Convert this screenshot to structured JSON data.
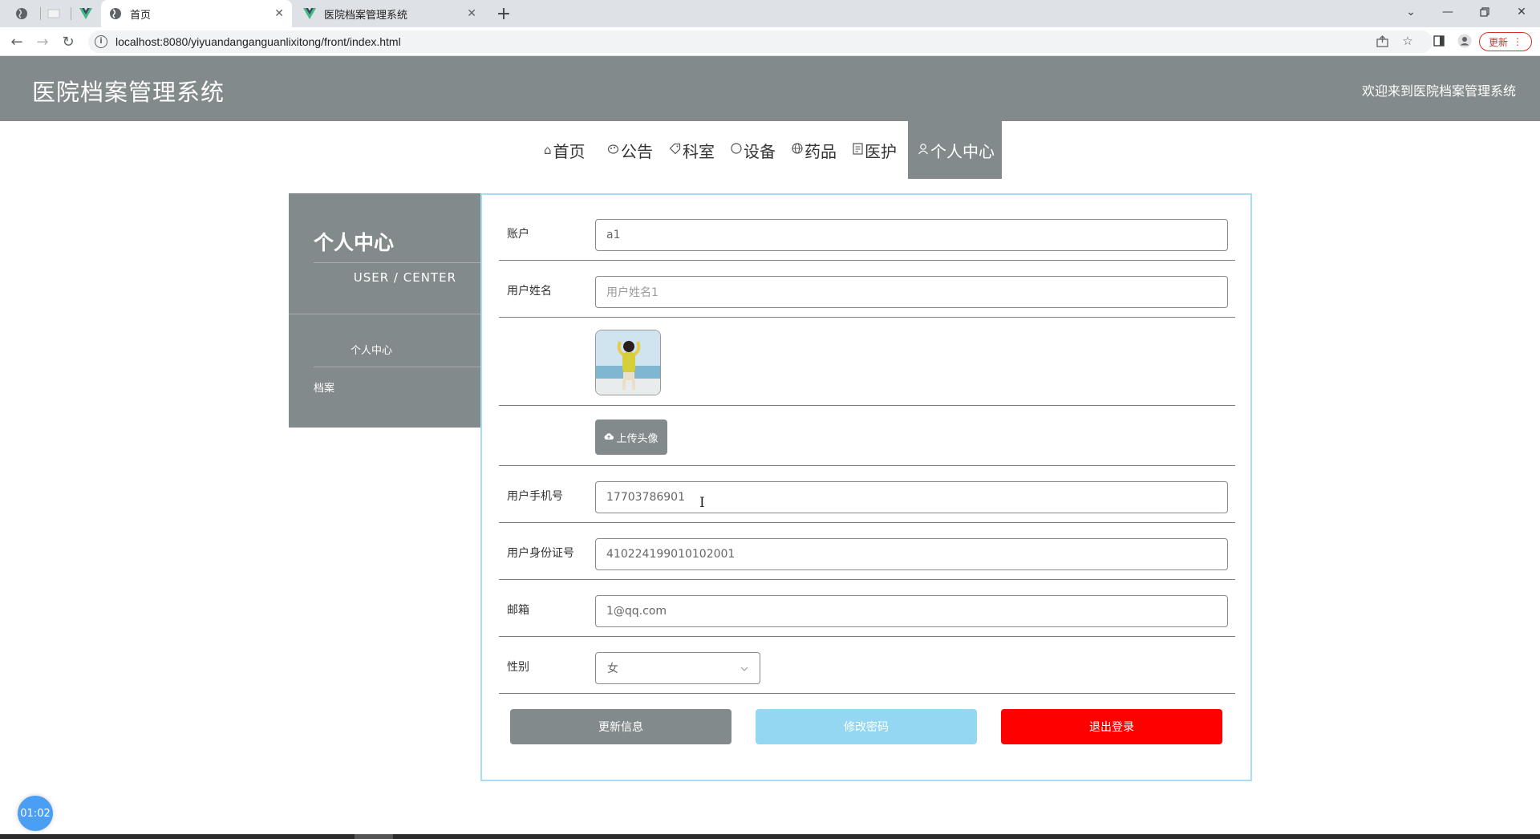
{
  "browser": {
    "tabs": [
      {
        "title": "首页",
        "active": true
      },
      {
        "title": "医院档案管理系统",
        "active": false
      }
    ],
    "url": "localhost:8080/yiyuandanganguanlixitong/front/index.html",
    "update_label": "更新"
  },
  "header": {
    "title": "医院档案管理系统",
    "welcome": "欢迎来到医院档案管理系统"
  },
  "nav": {
    "items": [
      {
        "label": "首页",
        "icon": "home-icon"
      },
      {
        "label": "公告",
        "icon": "announce-icon"
      },
      {
        "label": "科室",
        "icon": "tag-icon"
      },
      {
        "label": "设备",
        "icon": "circle-icon"
      },
      {
        "label": "药品",
        "icon": "globe-icon"
      },
      {
        "label": "医护",
        "icon": "doc-icon"
      },
      {
        "label": "个人中心",
        "icon": "user-icon",
        "active": true
      }
    ]
  },
  "sidebar": {
    "title": "个人中心",
    "subtitle": "USER / CENTER",
    "items": [
      {
        "label": "个人中心"
      },
      {
        "label": "档案"
      }
    ]
  },
  "form": {
    "account": {
      "label": "账户",
      "value": "a1"
    },
    "name": {
      "label": "用户姓名",
      "placeholder": "用户姓名1"
    },
    "upload_label": "上传头像",
    "phone": {
      "label": "用户手机号",
      "value": "17703786901"
    },
    "idcard": {
      "label": "用户身份证号",
      "value": "410224199010102001"
    },
    "email": {
      "label": "邮箱",
      "value": "1@qq.com"
    },
    "gender": {
      "label": "性别",
      "value": "女"
    },
    "buttons": {
      "update": "更新信息",
      "password": "修改密码",
      "logout": "退出登录"
    }
  },
  "colors": {
    "header_bg": "#838a8c",
    "panel_border": "#a9dcf0",
    "password_btn": "#94d7f2",
    "logout_btn": "#ff0000"
  },
  "timer": "01:02"
}
